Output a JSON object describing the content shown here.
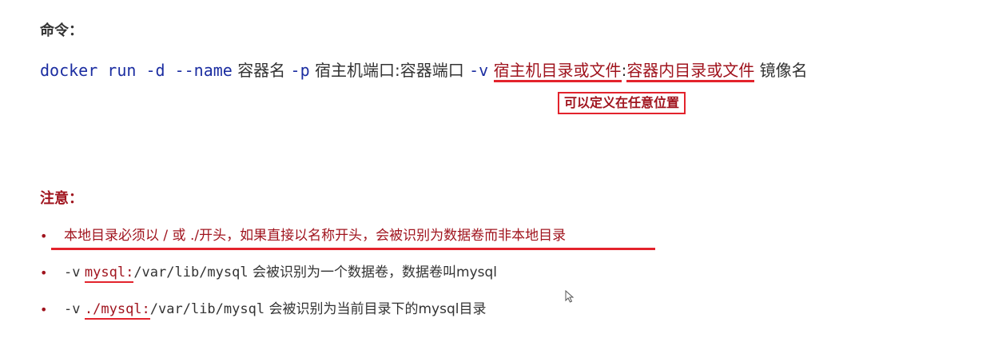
{
  "command_heading": "命令：",
  "command": {
    "prefix": "docker run -d --name",
    "container_name": "容器名",
    "opt_p": "-p",
    "ports": "宿主机端口:容器端口",
    "opt_v": "-v",
    "host_path": "宿主机目录或文件",
    "colon": ":",
    "container_path": "容器内目录或文件",
    "image": "镜像名"
  },
  "callout": "可以定义在任意位置",
  "notes_heading": "注意：",
  "bullets": [
    {
      "text": "本地目录必须以 / 或 ./开头，如果直接以名称开头，会被识别为数据卷而非本地目录"
    },
    {
      "opt": "-v",
      "highlight": "mysql:",
      "path": "/var/lib/mysql",
      "desc": "会被识别为一个数据卷，数据卷叫mysql"
    },
    {
      "opt": "-v",
      "highlight": "./mysql:",
      "path": "/var/lib/mysql",
      "desc": "会被识别为当前目录下的mysql目录"
    }
  ],
  "icons": {
    "bullet": "•",
    "cursor": "mouse-pointer-icon"
  }
}
